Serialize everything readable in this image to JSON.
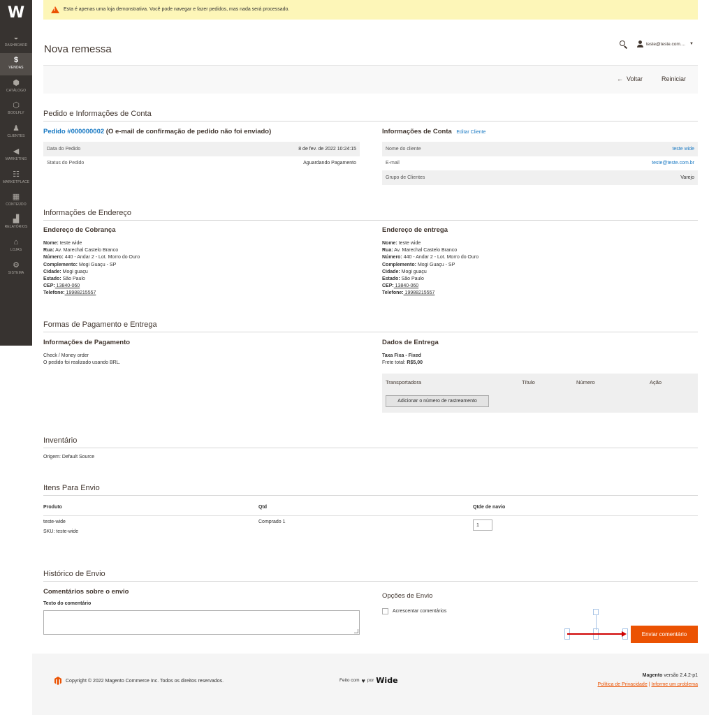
{
  "sidebar": {
    "logo": "W",
    "items": [
      {
        "label": "DASHBOARD",
        "icon": "dashboard-icon",
        "glyph": "◒"
      },
      {
        "label": "VENDAS",
        "icon": "dollar-icon",
        "glyph": "$"
      },
      {
        "label": "CATÁLOGO",
        "icon": "cube-icon",
        "glyph": "⬢"
      },
      {
        "label": "BOOLFLY",
        "icon": "hexagon-icon",
        "glyph": "⬡"
      },
      {
        "label": "CLIENTES",
        "icon": "person-icon",
        "glyph": "♟"
      },
      {
        "label": "MARKETING",
        "icon": "megaphone-icon",
        "glyph": "◀"
      },
      {
        "label": "MARKETPLACE",
        "icon": "sitemap-icon",
        "glyph": "☷"
      },
      {
        "label": "CONTEÚDO",
        "icon": "layout-icon",
        "glyph": "▦"
      },
      {
        "label": "RELATÓRIOS",
        "icon": "bar-chart-icon",
        "glyph": "▟"
      },
      {
        "label": "LOJAS",
        "icon": "store-icon",
        "glyph": "⌂"
      },
      {
        "label": "SISTEMA",
        "icon": "gear-icon",
        "glyph": "⚙"
      }
    ]
  },
  "notice": {
    "text": "Esta é apenas uma loja demonstrativa. Você pode navegar e fazer pedidos, mas nada será processado."
  },
  "header": {
    "title": "Nova remessa",
    "user": "teste@teste.com...."
  },
  "actions": {
    "back": "Voltar",
    "reset": "Reiniciar"
  },
  "order_account": {
    "section_title": "Pedido e Informações de Conta",
    "order_link": "Pedido #000000002",
    "order_note": "(O e-mail de confirmação de pedido não foi enviado)",
    "order_rows": [
      {
        "label": "Data do Pedido",
        "value": "8 de fev. de 2022 10:24:15"
      },
      {
        "label": "Status do Pedido",
        "value": "Aguardando Pagamento"
      }
    ],
    "account_title": "Informações de Conta",
    "edit_customer": "Editar Cliente",
    "account_rows": [
      {
        "label": "Nome do cliente",
        "value": "teste wide"
      },
      {
        "label": "E-mail",
        "value": "teste@teste.com.br"
      },
      {
        "label": "Grupo de Clientes",
        "value": "Varejo"
      }
    ]
  },
  "address": {
    "section_title": "Informações de Endereço",
    "billing_title": "Endereço de Cobrança",
    "shipping_title": "Endereço de entrega",
    "lines": [
      {
        "k": "Nome:",
        "v": " teste wide"
      },
      {
        "k": "Rua:",
        "v": " Av. Marechal Castelo Branco"
      },
      {
        "k": "Número:",
        "v": " 440 - Andar 2 - Lot. Morro do Ouro"
      },
      {
        "k": "Complemento:",
        "v": " Mogi Guaçu - SP"
      },
      {
        "k": "Cidade:",
        "v": " Mogi guaçu"
      },
      {
        "k": "Estado:",
        "v": " São Paulo"
      },
      {
        "k": "CEP:",
        "v": " 13840-060"
      },
      {
        "k": "Telefone:",
        "v": " 19988215557"
      }
    ]
  },
  "payment_shipping": {
    "section_title": "Formas de Pagamento e Entrega",
    "payment_title": "Informações de Pagamento",
    "payment_method": "Check / Money order",
    "payment_currency": "O pedido foi realizado usando BRL.",
    "shipping_title": "Dados de Entrega",
    "shipping_method": "Taxa Fixa - Fixed",
    "freight_label": "Frete total:",
    "freight_value": "R$5,00",
    "tracking_headers": [
      "Transportadora",
      "Título",
      "Número",
      "Ação"
    ],
    "add_tracking": "Adicionar o número de rastreamento"
  },
  "inventory": {
    "section_title": "Inventário",
    "origin": "Origem: Default Source"
  },
  "items": {
    "section_title": "Itens Para Envio",
    "headers": [
      "Produto",
      "Qtd",
      "Qtde de navio"
    ],
    "rows": [
      {
        "product": "teste-wide",
        "sku": "SKU: teste-wide",
        "qty": "Comprado 1",
        "ship_qty": "1"
      }
    ]
  },
  "history": {
    "section_title": "Histórico de Envio",
    "comments_title": "Comentários sobre o envio",
    "comment_label": "Texto do comentário",
    "options_title": "Opções de Envio",
    "append_comments": "Acrescentar comentários",
    "submit": "Enviar comentário"
  },
  "footer": {
    "copyright": "Copyright © 2022 Magento Commerce Inc. Todos os direitos reservados.",
    "made_with": "Feito com",
    "by": "por",
    "brand": "Wide",
    "version_brand": "Magento",
    "version": " versão 2.4.2-p1",
    "privacy": "Política de Privacidade",
    "separator": "|",
    "report": "Informe um problema"
  },
  "colors": {
    "sidebar": "#373330",
    "accent": "#eb5202",
    "link": "#1979c3",
    "notice": "#fdf6b8"
  }
}
